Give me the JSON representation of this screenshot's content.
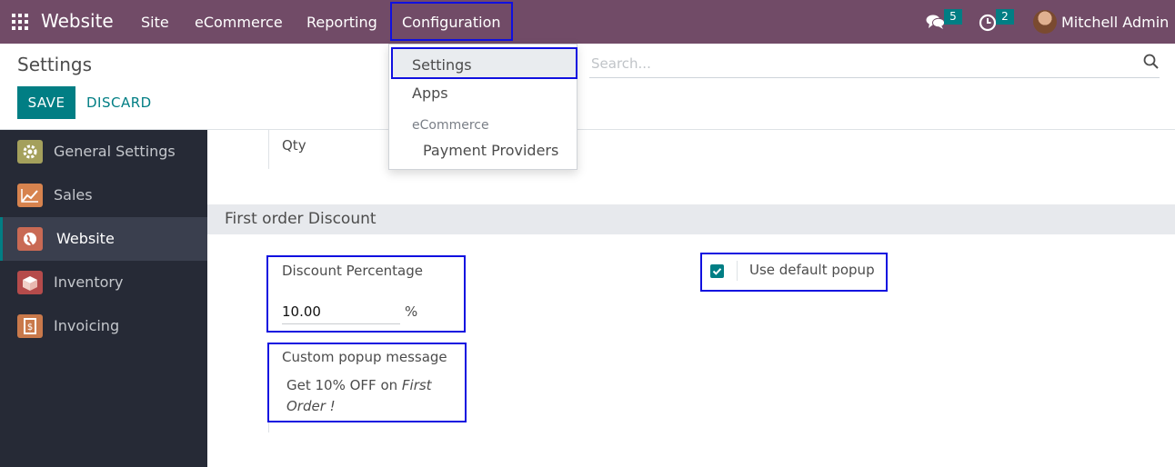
{
  "topbar": {
    "brand": "Website",
    "menu": [
      "Site",
      "eCommerce",
      "Reporting",
      "Configuration"
    ],
    "messages_count": "5",
    "activities_count": "2",
    "user_name": "Mitchell Admin"
  },
  "control_panel": {
    "title": "Settings",
    "save_label": "SAVE",
    "discard_label": "DISCARD",
    "search_placeholder": "Search..."
  },
  "dropdown": {
    "items": [
      "Settings",
      "Apps"
    ],
    "section_header": "eCommerce",
    "section_items": [
      "Payment Providers"
    ]
  },
  "sidebar": {
    "items": [
      {
        "label": "General Settings",
        "icon": "gear-icon",
        "color": "#a4a05c"
      },
      {
        "label": "Sales",
        "icon": "chart-icon",
        "color": "#d7834e"
      },
      {
        "label": "Website",
        "icon": "globe-icon",
        "color": "#c96a54",
        "active": true
      },
      {
        "label": "Inventory",
        "icon": "box-icon",
        "color": "#b54b4b"
      },
      {
        "label": "Invoicing",
        "icon": "invoice-icon",
        "color": "#c9794b"
      }
    ]
  },
  "content": {
    "qty_label": "Qty",
    "section_title": "First order Discount",
    "discount_label": "Discount Percentage",
    "discount_value": "10.00",
    "discount_unit": "%",
    "popup_label": "Custom popup message",
    "popup_message_plain": "Get 10% OFF on ",
    "popup_message_italic_1": "First",
    "popup_message_italic_2": "Order !",
    "default_popup_label": "Use default popup",
    "default_popup_checked": true
  },
  "colors": {
    "topbar": "#714b67",
    "primary": "#017e84",
    "sidebar": "#262a36",
    "highlight_box": "#1010e0"
  }
}
